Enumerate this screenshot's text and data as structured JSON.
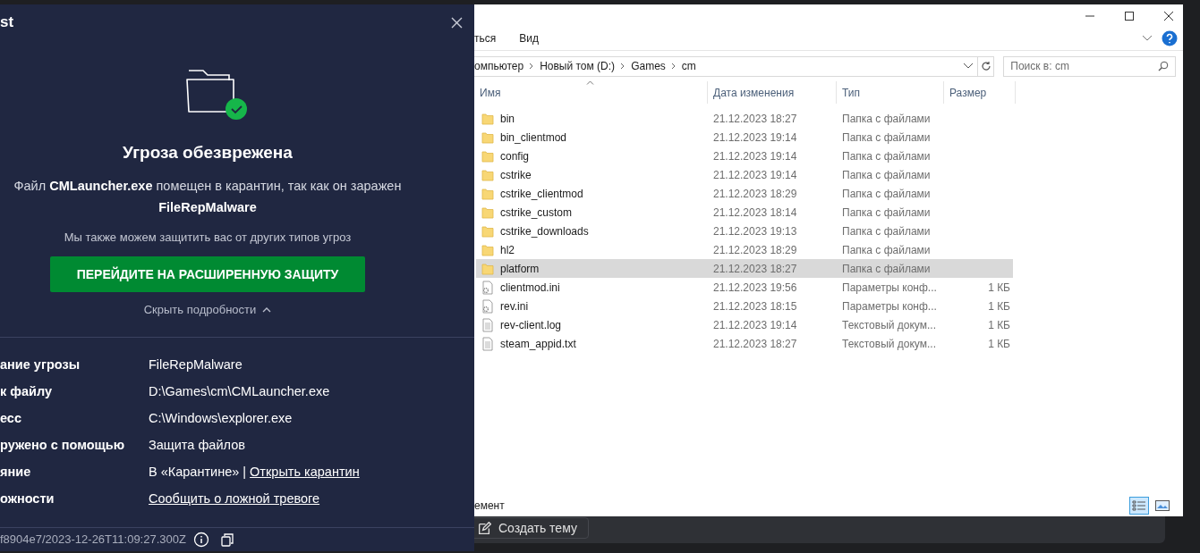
{
  "protection_dialog": {
    "title": "st",
    "heading": "Угроза обезврежена",
    "message": "Файл **CMLauncher.exe** помещен в карантин, так как он заражен\n**FileRepMalware**",
    "offer": "Мы также можем защитить вас от других типов угроз",
    "upgrade_button": "ПЕРЕЙДИТЕ НА РАСШИРЕННУЮ ЗАЩИТУ",
    "details_toggle": {
      "label": "Скрыть подробности",
      "expanded": true
    },
    "details": [
      {
        "label": "ание угрозы",
        "value": "FileRepMalware"
      },
      {
        "label": "к файлу",
        "value": "D:\\Games\\cm\\CMLauncher.exe"
      },
      {
        "label": "есс",
        "value": "C:\\Windows\\explorer.exe"
      },
      {
        "label": "ружено с помощью",
        "value": "Защита файлов"
      },
      {
        "label": "яние",
        "value": "В «Карантине» |",
        "link": "Открыть карантин"
      },
      {
        "label": "ожности",
        "link": "Сообщить о ложной тревоге"
      }
    ],
    "footer_id": "f8904e7/2023-12-26T11:09:27.300Z"
  },
  "explorer": {
    "ribbon_tabs": [
      "ться",
      "Вид"
    ],
    "breadcrumbs": [
      "омпьютер",
      "Новый том (D:)",
      "Games",
      "cm"
    ],
    "search": {
      "placeholder": "Поиск в: cm"
    },
    "columns": [
      "Имя",
      "Дата изменения",
      "Тип",
      "Размер"
    ],
    "rows": [
      {
        "kind": "folder",
        "name": "bin",
        "date": "21.12.2023 18:27",
        "type": "Папка с файлами",
        "selected": false
      },
      {
        "kind": "folder",
        "name": "bin_clientmod",
        "date": "21.12.2023 19:14",
        "type": "Папка с файлами",
        "selected": false
      },
      {
        "kind": "folder",
        "name": "config",
        "date": "21.12.2023 19:14",
        "type": "Папка с файлами",
        "selected": false
      },
      {
        "kind": "folder",
        "name": "cstrike",
        "date": "21.12.2023 19:14",
        "type": "Папка с файлами",
        "selected": false
      },
      {
        "kind": "folder",
        "name": "cstrike_clientmod",
        "date": "21.12.2023 18:29",
        "type": "Папка с файлами",
        "selected": false
      },
      {
        "kind": "folder",
        "name": "cstrike_custom",
        "date": "21.12.2023 18:14",
        "type": "Папка с файлами",
        "selected": false
      },
      {
        "kind": "folder",
        "name": "cstrike_downloads",
        "date": "21.12.2023 19:13",
        "type": "Папка с файлами",
        "selected": false
      },
      {
        "kind": "folder",
        "name": "hl2",
        "date": "21.12.2023 18:29",
        "type": "Папка с файлами",
        "selected": false
      },
      {
        "kind": "folder",
        "name": "platform",
        "date": "21.12.2023 18:27",
        "type": "Папка с файлами",
        "selected": true
      },
      {
        "kind": "config",
        "name": "clientmod.ini",
        "date": "21.12.2023 19:56",
        "type": "Параметры конф...",
        "size": "1 КБ",
        "selected": false
      },
      {
        "kind": "config",
        "name": "rev.ini",
        "date": "21.12.2023 18:15",
        "type": "Параметры конф...",
        "size": "1 КБ",
        "selected": false
      },
      {
        "kind": "text",
        "name": "rev-client.log",
        "date": "21.12.2023 19:14",
        "type": "Текстовый докум...",
        "size": "1 КБ",
        "selected": false
      },
      {
        "kind": "text",
        "name": "steam_appid.txt",
        "date": "21.12.2023 18:27",
        "type": "Текстовый докум...",
        "size": "1 КБ",
        "selected": false
      }
    ],
    "status": "емент",
    "view_modes": [
      {
        "kind": "details",
        "selected": true
      },
      {
        "kind": "tiles",
        "selected": false
      }
    ]
  },
  "background_window": {
    "button": "Создать тему"
  }
}
